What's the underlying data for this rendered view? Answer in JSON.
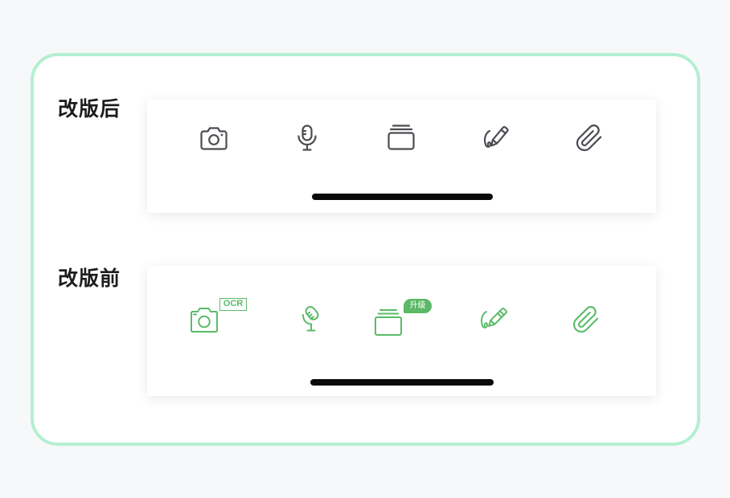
{
  "colors": {
    "page_background": "#f7f8fa",
    "card_border": "#b3efd1",
    "icon_dark": "#4c4c52",
    "icon_green": "#5abb68",
    "badge_green": "#5cb967",
    "home_indicator": "#0a0a0a"
  },
  "after": {
    "label": "改版后",
    "toolbar": [
      {
        "icon": "camera-icon"
      },
      {
        "icon": "microphone-icon"
      },
      {
        "icon": "card-stack-icon"
      },
      {
        "icon": "handwriting-icon"
      },
      {
        "icon": "paperclip-icon"
      }
    ]
  },
  "before": {
    "label": "改版前",
    "toolbar": [
      {
        "icon": "camera-icon",
        "badge": "OCR"
      },
      {
        "icon": "microphone-icon"
      },
      {
        "icon": "card-stack-icon",
        "badge": "升级"
      },
      {
        "icon": "handwriting-icon"
      },
      {
        "icon": "paperclip-icon"
      }
    ]
  }
}
